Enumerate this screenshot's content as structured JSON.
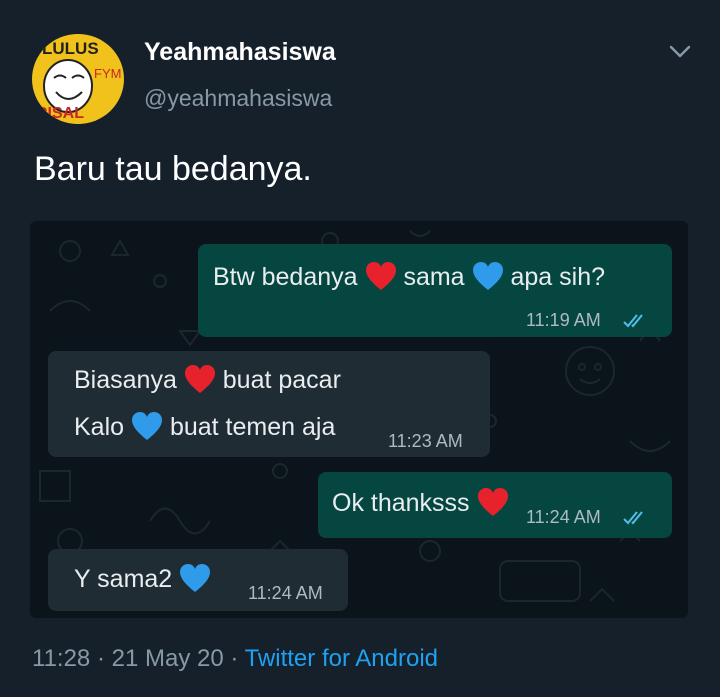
{
  "tweet": {
    "display_name": "Yeahmahasiswa",
    "handle": "@yeahmahasiswa",
    "text": "Baru tau bedanya.",
    "timestamp_time": "11:28",
    "separator1": " · ",
    "date": "21 May 20",
    "separator2": " · ",
    "source": "Twitter for Android",
    "avatar_text_top": "LULUS",
    "avatar_text_bottom": "RISAL",
    "avatar_text_side": "FYM"
  },
  "chat": {
    "messages": [
      {
        "direction": "outgoing",
        "part1": "Btw bedanya",
        "part2": "sama",
        "part3": "apa sih?",
        "time": "11:19 AM",
        "read": true
      },
      {
        "direction": "incoming",
        "line1_part1": "Biasanya",
        "line1_part2": "buat pacar",
        "line2_part1": "Kalo",
        "line2_part2": "buat temen aja",
        "time": "11:23 AM"
      },
      {
        "direction": "outgoing",
        "text": "Ok thanksss",
        "time": "11:24 AM",
        "read": true
      },
      {
        "direction": "incoming",
        "text": "Y sama2",
        "time": "11:24 AM"
      }
    ]
  },
  "colors": {
    "background": "#15202b",
    "chat_background": "#0b141a",
    "outgoing_bubble": "#054740",
    "incoming_bubble": "#1f2c34",
    "link": "#1da1f2",
    "secondary_text": "#8899a6",
    "read_ticks": "#53bdeb",
    "red_heart": "#e8222c",
    "blue_heart": "#2f9bea"
  },
  "icons": {
    "caret": "chevron-down-icon",
    "red_heart": "red-heart-emoji",
    "blue_heart": "blue-heart-emoji",
    "read_receipt": "double-check-icon"
  }
}
